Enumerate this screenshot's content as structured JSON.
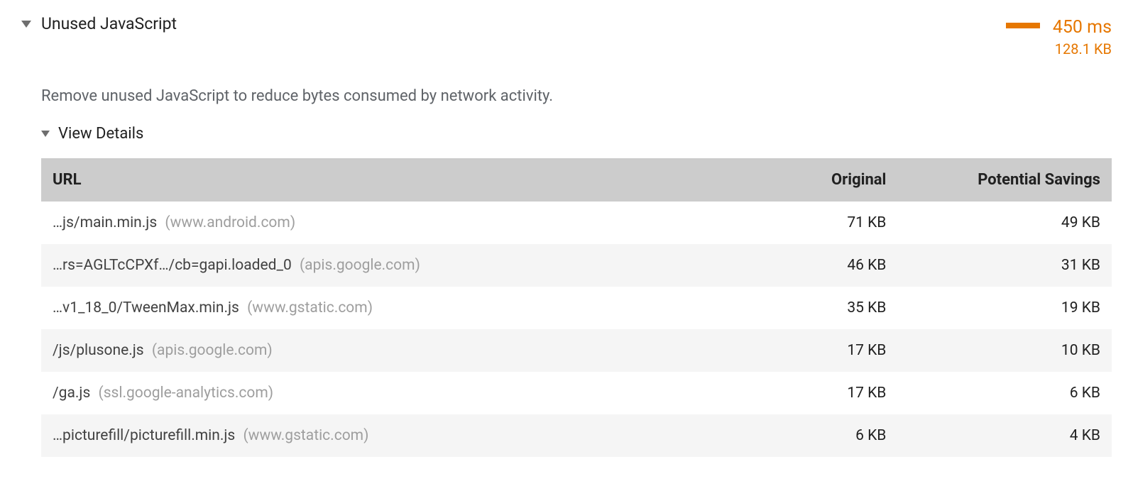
{
  "audit": {
    "title": "Unused JavaScript",
    "description": "Remove unused JavaScript to reduce bytes consumed by network activity.",
    "time": "450 ms",
    "size": "128.1 KB",
    "details_label": "View Details",
    "columns": {
      "url": "URL",
      "original": "Original",
      "savings": "Potential Savings"
    },
    "rows": [
      {
        "path": "…js/main.min.js",
        "host": "(www.android.com)",
        "original": "71 KB",
        "savings": "49 KB"
      },
      {
        "path": "…rs=AGLTcCPXf…/cb=gapi.loaded_0",
        "host": "(apis.google.com)",
        "original": "46 KB",
        "savings": "31 KB"
      },
      {
        "path": "…v1_18_0/TweenMax.min.js",
        "host": "(www.gstatic.com)",
        "original": "35 KB",
        "savings": "19 KB"
      },
      {
        "path": "/js/plusone.js",
        "host": "(apis.google.com)",
        "original": "17 KB",
        "savings": "10 KB"
      },
      {
        "path": "/ga.js",
        "host": "(ssl.google-analytics.com)",
        "original": "17 KB",
        "savings": "6 KB"
      },
      {
        "path": "…picturefill/picturefill.min.js",
        "host": "(www.gstatic.com)",
        "original": "6 KB",
        "savings": "4 KB"
      }
    ]
  }
}
